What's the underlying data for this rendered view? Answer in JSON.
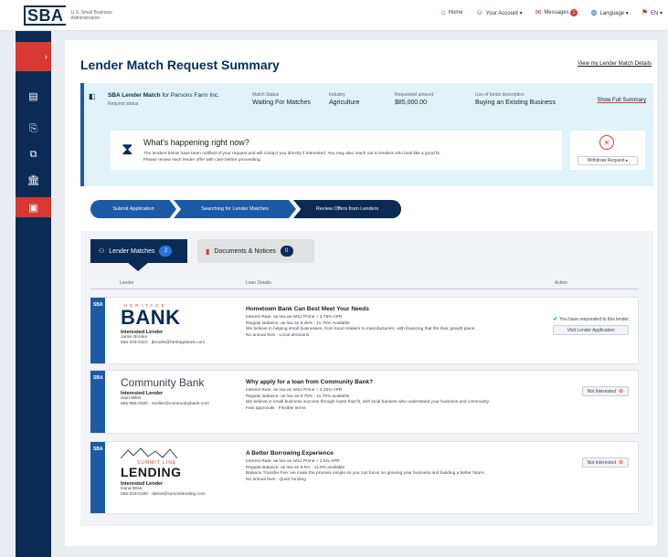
{
  "header": {
    "logo": "SBA",
    "logo_sub": "U.S. Small Business Administration",
    "nav": [
      {
        "icon": "home-icon",
        "label": "Home"
      },
      {
        "icon": "user-icon",
        "label": "Your Account ▾"
      },
      {
        "icon": "mail-icon",
        "label": "Messages",
        "badge": "1"
      },
      {
        "icon": "globe-icon",
        "label": "Language ▾"
      },
      {
        "icon": "flag-icon",
        "label": "EN ▾"
      }
    ]
  },
  "rail": {
    "expand_icon": "›",
    "items": [
      "▤",
      "⎘",
      "⧉",
      "🏛",
      "▣"
    ]
  },
  "page": {
    "title": "Lender Match Request Summary",
    "view_link": "View my Lender Match Details"
  },
  "summary": {
    "brand": "SBA Lender Match",
    "for_text": "for Parsons Farm Inc.",
    "sub": "Request status",
    "cols": [
      {
        "label": "Match Status",
        "value": "Waiting For Matches"
      },
      {
        "label": "Industry",
        "value": "Agriculture"
      },
      {
        "label": "Requested amount",
        "value": "$85,000.00"
      },
      {
        "label": "Use of funds description",
        "value": "Buying an Existing Business"
      }
    ],
    "show_full": "Show Full Summary"
  },
  "happening": {
    "title": "What's happening right now?",
    "text1": "The lenders below have been notified of your request and will contact you directly if interested. You may also reach out to lenders who look like a good fit.",
    "text2": "Please review each lender offer with care before proceeding."
  },
  "withdraw": {
    "label": "Withdraw Request ▸"
  },
  "steps": [
    "Submit Application",
    "Searching for Lender Matches",
    "Review Offers from Lenders"
  ],
  "tabs": [
    {
      "label": "Lender Matches",
      "count": "2"
    },
    {
      "label": "Documents & Notices",
      "count": "0"
    }
  ],
  "table_headers": [
    "Lender",
    "Loan Details",
    "Action"
  ],
  "lenders": [
    {
      "tag": "SBA",
      "top": "HERITAGE",
      "name": "BANK",
      "status": "Interested Lender",
      "contact": "Jamie Brooks",
      "phone": "555-333-0110 · jbrooks@heritagebank.com",
      "loan_title": "Hometown Bank Can Best Meet Your Needs",
      "loan_lines": [
        "Interest Rate: as low as WSJ Prime + 2.75% APR",
        "Regular Balance: as low as 8.25% - 11.75% Available",
        "We believe in helping small businesses, from local retailers to manufacturers, with financing that fits their growth plans.",
        "No annual fees · Local decisions"
      ],
      "action_ok": "You have responded to this lender",
      "action": "Visit Lender Application"
    },
    {
      "tag": "SBA",
      "name": "Community Bank",
      "status": "Interested Lender",
      "contact": "Sam Miller",
      "phone": "555-555-0100 · smiller@communitybank.com",
      "loan_title": "Why apply for a loan from Community Bank?",
      "loan_lines": [
        "Interest Rate: as low as WSJ Prime + 2.25% APR",
        "Regular Balance: as low as 8.75% - 11.75% available",
        "We believe in small business success through loans that fit, with local bankers who understand your business and community.",
        "Fast approvals · Flexible terms"
      ],
      "action": "Not Interested"
    },
    {
      "tag": "SBA",
      "top": "SUMMIT LINE",
      "name": "LENDING",
      "status": "Interested Lender",
      "contact": "Dana Wise",
      "phone": "555-333-0150 · dwise@summitlending.com",
      "loan_title": "A Better Borrowing Experience",
      "loan_lines": [
        "Interest Rate: as low as WSJ Prime + 2.5% APR",
        "Regular Balance: as low as 8.5% - 11.5% available",
        "Balance Transfer Fee: we make the process simple so you can focus on growing your business and building a better future.",
        "No annual fees · Quick funding"
      ],
      "action": "Not Interested"
    }
  ]
}
